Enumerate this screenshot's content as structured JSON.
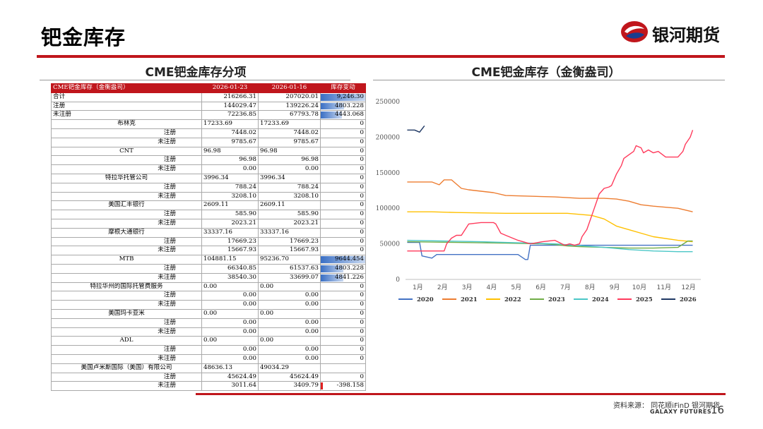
{
  "page": {
    "title": "钯金库存",
    "logo_text": "银河期货",
    "source": "资料来源：  同花顺iFinD 银河期货",
    "galaxy_en": "GALAXY FUTURES",
    "page_number": "16"
  },
  "left_section": {
    "title": "CME钯金库存分项"
  },
  "right_section": {
    "title": "CME钯金库存（金衡盎司）"
  },
  "table": {
    "headers": [
      "CME钯金库存（金衡盎司）",
      "2026-01-23",
      "2026-01-16",
      "库存变动"
    ],
    "rows": [
      {
        "name": "合计",
        "a": "216266.31",
        "b": "207020.01",
        "c": "9,246.30",
        "align": "l",
        "val": "r",
        "bar": 1.0
      },
      {
        "name": "注册",
        "a": "144029.47",
        "b": "139226.24",
        "c": "4803.228",
        "align": "l",
        "val": "r",
        "bar": 0.52
      },
      {
        "name": "未注册",
        "a": "72236.85",
        "b": "67793.78",
        "c": "4443.068",
        "align": "l",
        "val": "r",
        "bar": 0.48
      },
      {
        "name": "布林克",
        "a": "17233.69",
        "b": "17233.69",
        "c": "0",
        "align": "c",
        "val": "l",
        "bar": 0
      },
      {
        "name": "注册",
        "a": "7448.02",
        "b": "7448.02",
        "c": "0",
        "align": "r",
        "val": "r",
        "bar": 0
      },
      {
        "name": "未注册",
        "a": "9785.67",
        "b": "9785.67",
        "c": "0",
        "align": "r",
        "val": "r",
        "bar": 0
      },
      {
        "name": "CNT",
        "a": "96.98",
        "b": "96.98",
        "c": "0",
        "align": "c",
        "val": "l",
        "bar": 0
      },
      {
        "name": "注册",
        "a": "96.98",
        "b": "96.98",
        "c": "0",
        "align": "r",
        "val": "r",
        "bar": 0
      },
      {
        "name": "未注册",
        "a": "0.00",
        "b": "0.00",
        "c": "0",
        "align": "r",
        "val": "r",
        "bar": 0
      },
      {
        "name": "特拉华托管公司",
        "a": "3996.34",
        "b": "3996.34",
        "c": "0",
        "align": "c",
        "val": "l",
        "bar": 0
      },
      {
        "name": "注册",
        "a": "788.24",
        "b": "788.24",
        "c": "0",
        "align": "r",
        "val": "r",
        "bar": 0
      },
      {
        "name": "未注册",
        "a": "3208.10",
        "b": "3208.10",
        "c": "0",
        "align": "r",
        "val": "r",
        "bar": 0
      },
      {
        "name": "美国汇丰银行",
        "a": "2609.11",
        "b": "2609.11",
        "c": "0",
        "align": "c",
        "val": "l",
        "bar": 0
      },
      {
        "name": "注册",
        "a": "585.90",
        "b": "585.90",
        "c": "0",
        "align": "r",
        "val": "r",
        "bar": 0
      },
      {
        "name": "未注册",
        "a": "2023.21",
        "b": "2023.21",
        "c": "0",
        "align": "r",
        "val": "r",
        "bar": 0
      },
      {
        "name": "摩根大通银行",
        "a": "33337.16",
        "b": "33337.16",
        "c": "0",
        "align": "c",
        "val": "l",
        "bar": 0
      },
      {
        "name": "注册",
        "a": "17669.23",
        "b": "17669.23",
        "c": "0",
        "align": "r",
        "val": "r",
        "bar": 0
      },
      {
        "name": "未注册",
        "a": "15667.93",
        "b": "15667.93",
        "c": "0",
        "align": "r",
        "val": "r",
        "bar": 0
      },
      {
        "name": "MTB",
        "a": "104881.15",
        "b": "95236.70",
        "c": "9644.454",
        "align": "c",
        "val": "l",
        "bar": 1.0
      },
      {
        "name": "注册",
        "a": "66340.85",
        "b": "61537.63",
        "c": "4803.228",
        "align": "r",
        "val": "r",
        "bar": 0.5
      },
      {
        "name": "未注册",
        "a": "38540.30",
        "b": "33699.07",
        "c": "4841.226",
        "align": "r",
        "val": "r",
        "bar": 0.5
      },
      {
        "name": "特拉华州的国际托管费服务",
        "a": "0.00",
        "b": "0.00",
        "c": "0",
        "align": "c",
        "val": "l",
        "bar": 0
      },
      {
        "name": "注册",
        "a": "0.00",
        "b": "0.00",
        "c": "0",
        "align": "r",
        "val": "r",
        "bar": 0
      },
      {
        "name": "未注册",
        "a": "0.00",
        "b": "0.00",
        "c": "0",
        "align": "r",
        "val": "r",
        "bar": 0
      },
      {
        "name": "美国玛卡亚米",
        "a": "0.00",
        "b": "0.00",
        "c": "0",
        "align": "c",
        "val": "l",
        "bar": 0
      },
      {
        "name": "注册",
        "a": "0.00",
        "b": "0.00",
        "c": "0",
        "align": "r",
        "val": "r",
        "bar": 0
      },
      {
        "name": "未注册",
        "a": "0.00",
        "b": "0.00",
        "c": "0",
        "align": "r",
        "val": "r",
        "bar": 0
      },
      {
        "name": "ADL",
        "a": "0.00",
        "b": "0.00",
        "c": "0",
        "align": "c",
        "val": "l",
        "bar": 0
      },
      {
        "name": "注册",
        "a": "0.00",
        "b": "0.00",
        "c": "0",
        "align": "r",
        "val": "r",
        "bar": 0
      },
      {
        "name": "未注册",
        "a": "0.00",
        "b": "0.00",
        "c": "0",
        "align": "r",
        "val": "r",
        "bar": 0
      },
      {
        "name": "美国卢米斯国际（美国）有限公司",
        "a": "48636.13",
        "b": "49034.29",
        "c": "",
        "align": "c",
        "val": "l",
        "bar": 0
      },
      {
        "name": "注册",
        "a": "45624.49",
        "b": "45624.49",
        "c": "0",
        "align": "r",
        "val": "r",
        "bar": 0
      },
      {
        "name": "未注册",
        "a": "3011.64",
        "b": "3409.79",
        "c": "-398.158",
        "align": "r",
        "val": "r",
        "bar": -0.04
      }
    ]
  },
  "chart_data": {
    "type": "line",
    "title": "CME钯金库存（金衡盎司）",
    "xlabel": "",
    "ylabel": "",
    "categories": [
      "1月",
      "2月",
      "3月",
      "4月",
      "5月",
      "6月",
      "7月",
      "8月",
      "9月",
      "10月",
      "11月",
      "12月"
    ],
    "yticks": [
      "0",
      "50000",
      "100000",
      "150000",
      "200000",
      "250000"
    ],
    "ylim": [
      0,
      250000
    ],
    "grid": false,
    "legend": "bottom",
    "series": [
      {
        "name": "2020",
        "color": "#4472c4",
        "x": [
          0,
          0.5,
          0.6,
          1.0,
          1.2,
          2.0,
          4.5,
          4.8,
          4.9,
          5.0,
          6.5,
          11.6
        ],
        "values": [
          52000,
          52000,
          33000,
          30000,
          35000,
          35000,
          35000,
          28000,
          28000,
          48000,
          48000,
          48000
        ]
      },
      {
        "name": "2021",
        "color": "#ed7d31",
        "x": [
          0,
          1.0,
          1.3,
          1.5,
          1.8,
          2.2,
          2.5,
          3.0,
          3.5,
          4.0,
          5.0,
          6.0,
          6.5,
          7.0,
          8.0,
          8.5,
          9.0,
          9.5,
          10.0,
          11.0,
          11.6
        ],
        "values": [
          137000,
          137000,
          133000,
          140000,
          140000,
          128000,
          126000,
          124000,
          122000,
          118000,
          117000,
          116000,
          115000,
          114000,
          114000,
          113000,
          110000,
          105000,
          103000,
          100000,
          95000
        ]
      },
      {
        "name": "2022",
        "color": "#ffc000",
        "x": [
          0,
          1.0,
          2.0,
          4.0,
          6.5,
          7.5,
          8.0,
          8.5,
          9.0,
          9.5,
          10.0,
          11.0,
          11.6
        ],
        "values": [
          95000,
          95000,
          94000,
          93000,
          93000,
          90000,
          85000,
          75000,
          70000,
          65000,
          60000,
          55000,
          53000
        ]
      },
      {
        "name": "2023",
        "color": "#70ad47",
        "x": [
          0,
          2.0,
          4.0,
          5.5,
          6.0,
          6.5,
          7.0,
          8.0,
          9.0,
          10.0,
          11.0,
          11.4,
          11.6
        ],
        "values": [
          53000,
          52000,
          51000,
          50000,
          49000,
          47000,
          46000,
          45000,
          44000,
          44000,
          45000,
          54000,
          54000
        ]
      },
      {
        "name": "2024",
        "color": "#4bc7c7",
        "x": [
          0,
          3.0,
          6.0,
          8.0,
          9.0,
          10.0,
          11.0,
          11.6
        ],
        "values": [
          55000,
          53000,
          50000,
          45000,
          42000,
          40000,
          39000,
          39000
        ]
      },
      {
        "name": "2025",
        "color": "#ff3b5c",
        "x": [
          0,
          1.5,
          1.6,
          1.8,
          2.0,
          2.2,
          2.5,
          3.0,
          3.5,
          3.6,
          3.8,
          4.0,
          4.5,
          5.0,
          5.5,
          6.0,
          6.4,
          6.6,
          6.8,
          7.0,
          7.1,
          7.3,
          7.5,
          7.7,
          7.8,
          8.0,
          8.2,
          8.3,
          8.5,
          8.7,
          8.8,
          9.0,
          9.2,
          9.3,
          9.5,
          9.6,
          9.8,
          10.0,
          10.2,
          10.5,
          10.8,
          11.0,
          11.2,
          11.3,
          11.5,
          11.6
        ],
        "values": [
          40000,
          40000,
          50000,
          58000,
          62000,
          62000,
          78000,
          80000,
          80000,
          78000,
          65000,
          62000,
          55000,
          50000,
          53000,
          55000,
          48000,
          50000,
          48000,
          50000,
          60000,
          70000,
          90000,
          110000,
          120000,
          128000,
          130000,
          132000,
          148000,
          160000,
          170000,
          175000,
          180000,
          188000,
          185000,
          178000,
          182000,
          178000,
          180000,
          172000,
          172000,
          172000,
          180000,
          190000,
          200000,
          210000
        ]
      },
      {
        "name": "2026",
        "color": "#1f3864",
        "x": [
          0,
          0.3,
          0.5,
          0.7
        ],
        "values": [
          210000,
          210000,
          207000,
          216000
        ]
      }
    ]
  }
}
